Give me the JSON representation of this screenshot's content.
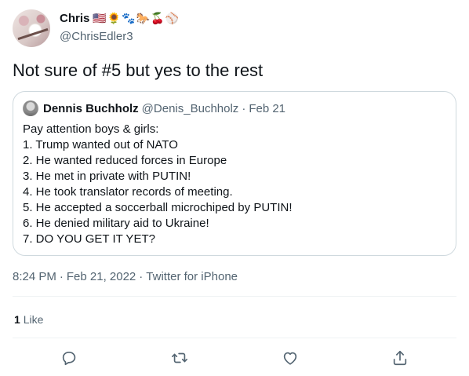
{
  "author": {
    "display_name": "Chris",
    "emojis": "🇺🇸🌻🐾🐎🍒⚾",
    "handle": "@ChrisEdler3"
  },
  "tweet_text": "Not sure of #5 but yes to the rest",
  "quoted_tweet": {
    "display_name": "Dennis Buchholz",
    "handle": "@Denis_Buchholz",
    "separator": "·",
    "date": "Feb 21",
    "lines": [
      "Pay attention boys & girls:",
      "1. Trump wanted out of NATO",
      "2. He wanted reduced forces in Europe",
      "3. He met in private with PUTIN!",
      "4. He took translator records of meeting.",
      "5. He accepted a soccerball microchiped by PUTIN!",
      "6. He denied military aid to Ukraine!",
      "7. DO YOU GET IT YET?"
    ]
  },
  "meta": {
    "time": "8:24 PM",
    "separator": "·",
    "date": "Feb 21, 2022",
    "separator2": "·",
    "source": "Twitter for iPhone"
  },
  "engagement": {
    "like_count": "1",
    "like_label": "Like"
  },
  "actions": {
    "reply_icon": "reply-icon",
    "retweet_icon": "retweet-icon",
    "like_icon": "heart-icon",
    "share_icon": "share-icon",
    "icon_color": "#536471"
  }
}
